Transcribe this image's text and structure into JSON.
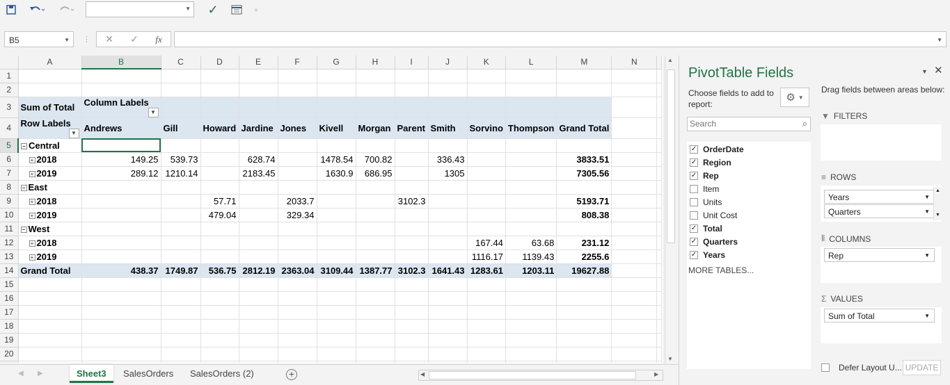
{
  "formula_bar": {
    "name_box": "B5",
    "fx_label": "fx",
    "formula": ""
  },
  "columns": [
    "A",
    "B",
    "C",
    "D",
    "E",
    "F",
    "G",
    "H",
    "I",
    "J",
    "K",
    "L",
    "M",
    "N"
  ],
  "rows": [
    [
      "",
      "",
      "",
      "",
      "",
      "",
      "",
      "",
      "",
      "",
      "",
      "",
      "",
      ""
    ],
    [
      "",
      "",
      "",
      "",
      "",
      "",
      "",
      "",
      "",
      "",
      "",
      "",
      "",
      ""
    ],
    [
      "Sum of Total",
      "Column Labels",
      "",
      "",
      "",
      "",
      "",
      "",
      "",
      "",
      "",
      "",
      "",
      ""
    ],
    [
      "Row Labels",
      "Andrews",
      "Gill",
      "Howard",
      "Jardine",
      "Jones",
      "Kivell",
      "Morgan",
      "Parent",
      "Smith",
      "Sorvino",
      "Thompson",
      "Grand Total",
      ""
    ],
    [
      "Central",
      "",
      "",
      "",
      "",
      "",
      "",
      "",
      "",
      "",
      "",
      "",
      "",
      ""
    ],
    [
      "2018",
      "149.25",
      "539.73",
      "",
      "628.74",
      "",
      "1478.54",
      "700.82",
      "",
      "336.43",
      "",
      "",
      "3833.51",
      ""
    ],
    [
      "2019",
      "289.12",
      "1210.14",
      "",
      "2183.45",
      "",
      "1630.9",
      "686.95",
      "",
      "1305",
      "",
      "",
      "7305.56",
      ""
    ],
    [
      "East",
      "",
      "",
      "",
      "",
      "",
      "",
      "",
      "",
      "",
      "",
      "",
      "",
      ""
    ],
    [
      "2018",
      "",
      "",
      "57.71",
      "",
      "2033.7",
      "",
      "",
      "3102.3",
      "",
      "",
      "",
      "5193.71",
      ""
    ],
    [
      "2019",
      "",
      "",
      "479.04",
      "",
      "329.34",
      "",
      "",
      "",
      "",
      "",
      "",
      "808.38",
      ""
    ],
    [
      "West",
      "",
      "",
      "",
      "",
      "",
      "",
      "",
      "",
      "",
      "",
      "",
      "",
      ""
    ],
    [
      "2018",
      "",
      "",
      "",
      "",
      "",
      "",
      "",
      "",
      "",
      "167.44",
      "63.68",
      "231.12",
      ""
    ],
    [
      "2019",
      "",
      "",
      "",
      "",
      "",
      "",
      "",
      "",
      "",
      "1116.17",
      "1139.43",
      "2255.6",
      ""
    ],
    [
      "Grand Total",
      "438.37",
      "1749.87",
      "536.75",
      "2812.19",
      "2363.04",
      "3109.44",
      "1387.77",
      "3102.3",
      "1641.43",
      "1283.61",
      "1203.11",
      "19627.88",
      ""
    ],
    [
      "",
      "",
      "",
      "",
      "",
      "",
      "",
      "",
      "",
      "",
      "",
      "",
      "",
      ""
    ],
    [
      "",
      "",
      "",
      "",
      "",
      "",
      "",
      "",
      "",
      "",
      "",
      "",
      "",
      ""
    ],
    [
      "",
      "",
      "",
      "",
      "",
      "",
      "",
      "",
      "",
      "",
      "",
      "",
      "",
      ""
    ],
    [
      "",
      "",
      "",
      "",
      "",
      "",
      "",
      "",
      "",
      "",
      "",
      "",
      "",
      ""
    ],
    [
      "",
      "",
      "",
      "",
      "",
      "",
      "",
      "",
      "",
      "",
      "",
      "",
      "",
      ""
    ],
    [
      "",
      "",
      "",
      "",
      "",
      "",
      "",
      "",
      "",
      "",
      "",
      "",
      "",
      ""
    ],
    [
      "",
      "",
      "",
      "",
      "",
      "",
      "",
      "",
      "",
      "",
      "",
      "",
      "",
      ""
    ]
  ],
  "sheet_tabs": [
    "Sheet3",
    "SalesOrders",
    "SalesOrders (2)"
  ],
  "pivot_pane": {
    "title": "PivotTable Fields",
    "choose_label": "Choose fields to add to report:",
    "drag_label": "Drag fields between areas below:",
    "search_placeholder": "Search",
    "fields": [
      {
        "name": "OrderDate",
        "checked": true
      },
      {
        "name": "Region",
        "checked": true
      },
      {
        "name": "Rep",
        "checked": true
      },
      {
        "name": "Item",
        "checked": false
      },
      {
        "name": "Units",
        "checked": false
      },
      {
        "name": "Unit Cost",
        "checked": false
      },
      {
        "name": "Total",
        "checked": true
      },
      {
        "name": "Quarters",
        "checked": true
      },
      {
        "name": "Years",
        "checked": true
      }
    ],
    "more_tables": "MORE TABLES...",
    "filters_label": "FILTERS",
    "rows_label": "ROWS",
    "rows_items": [
      "Years",
      "Quarters"
    ],
    "columns_label": "COLUMNS",
    "columns_items": [
      "Rep"
    ],
    "values_label": "VALUES",
    "values_items": [
      "Sum of Total"
    ],
    "defer_label": "Defer Layout U...",
    "update_label": "UPDATE"
  },
  "colors": {
    "accent": "#217346",
    "pivot_header": "#dce6f1"
  }
}
